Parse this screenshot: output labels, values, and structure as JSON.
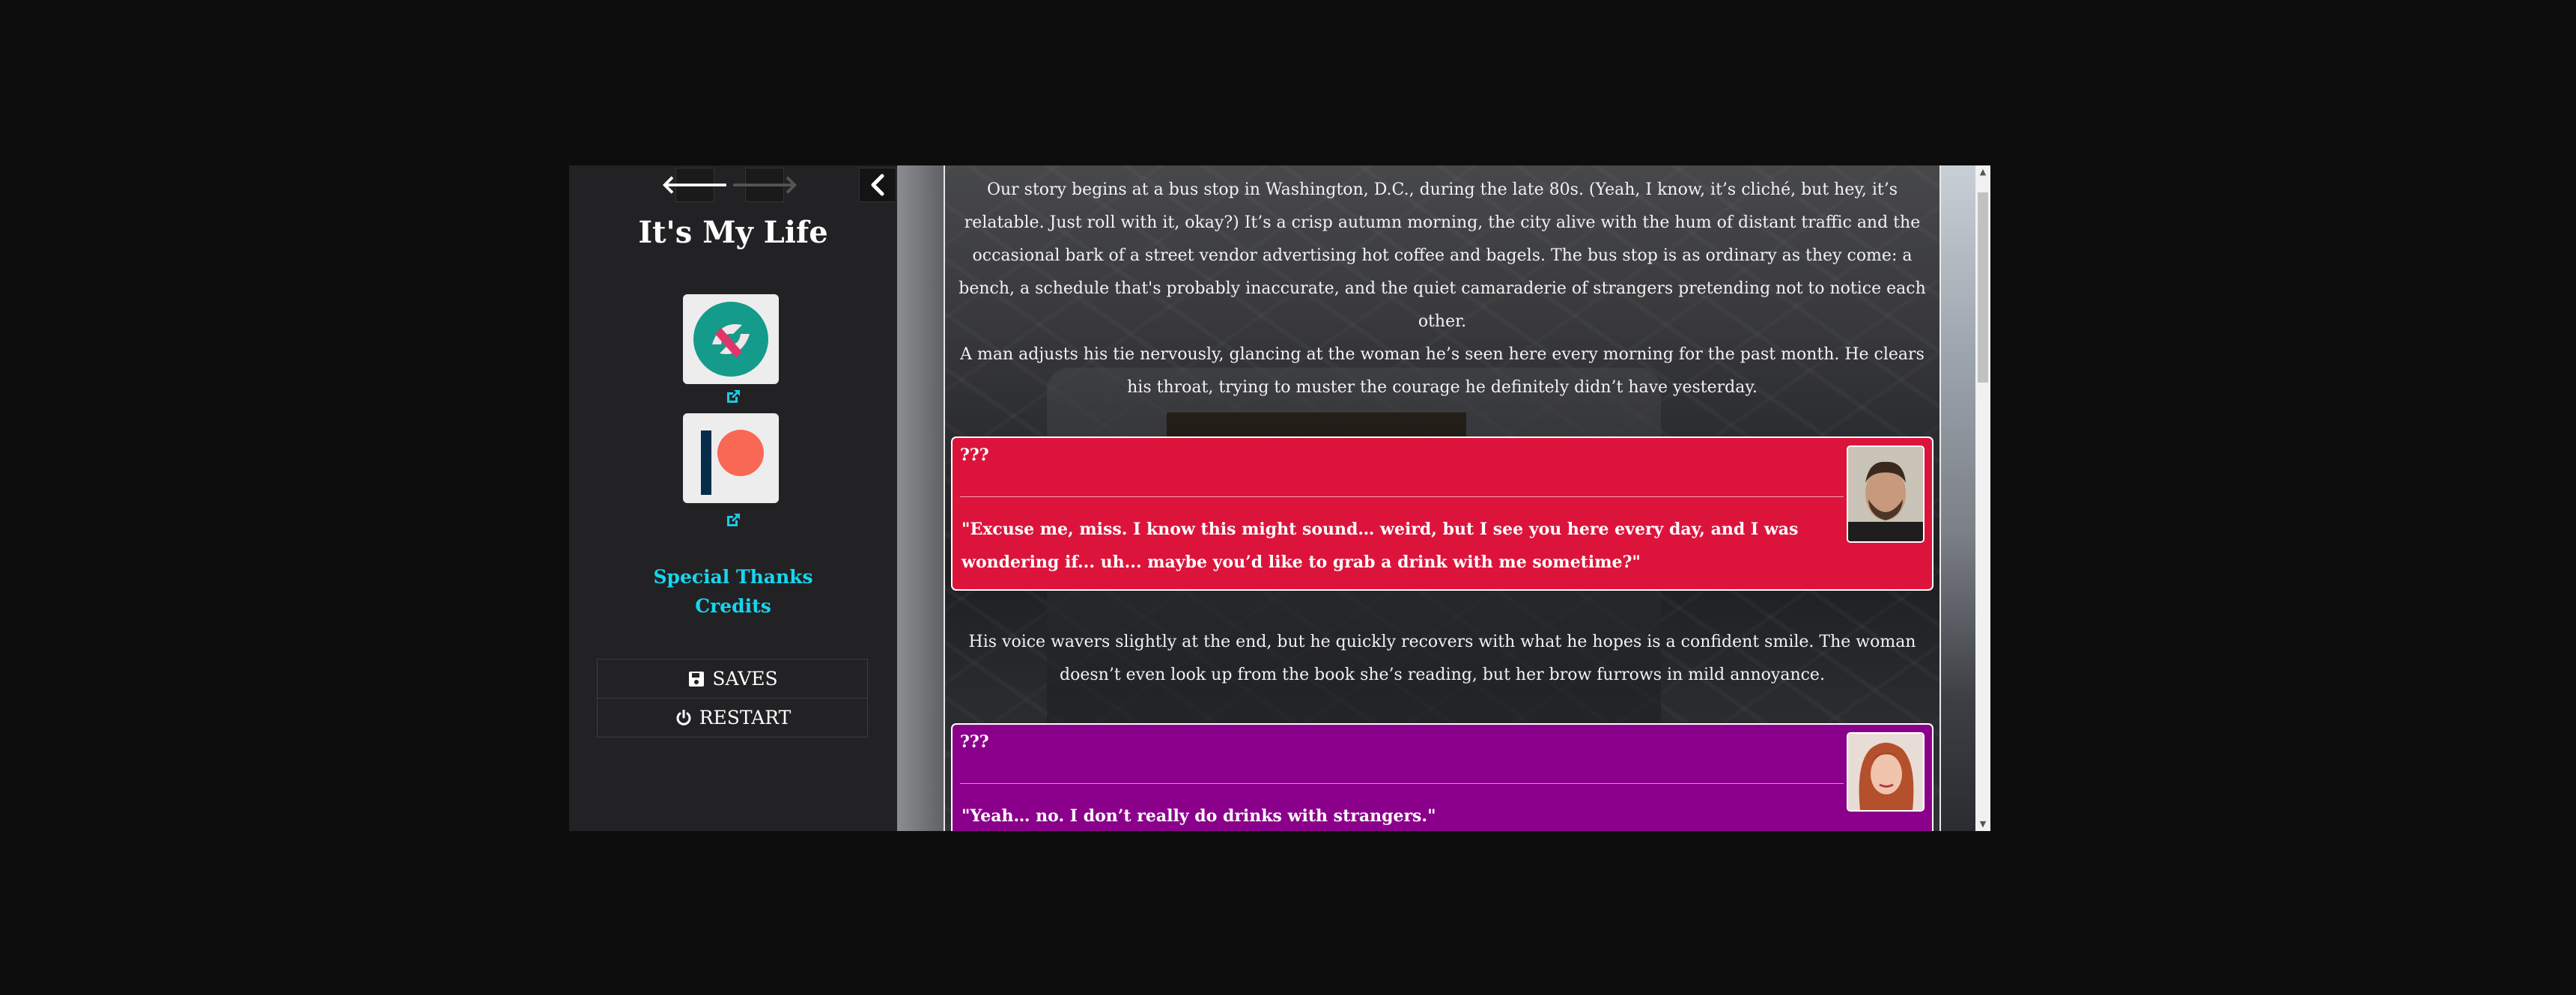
{
  "sidebar": {
    "title": "It's My Life",
    "links": {
      "special_thanks": "Special Thanks",
      "credits": "Credits"
    },
    "menu": {
      "saves": "SAVES",
      "restart": "RESTART"
    },
    "icons": {
      "back": "arrow-left-icon",
      "forward": "arrow-right-icon",
      "collapse": "chevron-left-icon",
      "logo1": "subscribestar-logo",
      "logo2": "patreon-logo",
      "external": "external-link-icon",
      "save": "floppy-disk-icon",
      "power": "power-icon"
    }
  },
  "story": {
    "para1": "Our story begins at a bus stop in Washington, D.C., during the late 80s. (Yeah, I know, it’s cliché, but hey, it’s relatable. Just roll with it, okay?) It’s a crisp autumn morning, the city alive with the hum of distant traffic and the occasional bark of a street vendor advertising hot coffee and bagels. The bus stop is as ordinary as they come: a bench, a schedule that's probably inaccurate, and the quiet camaraderie of strangers pretending not to notice each other.",
    "para2": "A man adjusts his tie nervously, glancing at the woman he’s seen here every morning for the past month. He clears his throat, trying to muster the courage he definitely didn’t have yesterday.",
    "dialog1": {
      "speaker": "???",
      "text": "\"Excuse me, miss. I know this might sound… weird, but I see you here every day, and I was wondering if... uh... maybe you’d like to grab a drink with me sometime?\"",
      "color": "#dc143c"
    },
    "para3": "His voice wavers slightly at the end, but he quickly recovers with what he hopes is a confident smile. The woman doesn’t even look up from the book she’s reading, but her brow furrows in mild annoyance.",
    "dialog2": {
      "speaker": "???",
      "text": "\"Yeah… no. I don’t really do drinks with strangers.\"",
      "color": "#8b008b"
    }
  },
  "colors": {
    "link": "#17d6ef",
    "sidebar_bg": "#222224",
    "page_bg": "#0d0d0d"
  }
}
